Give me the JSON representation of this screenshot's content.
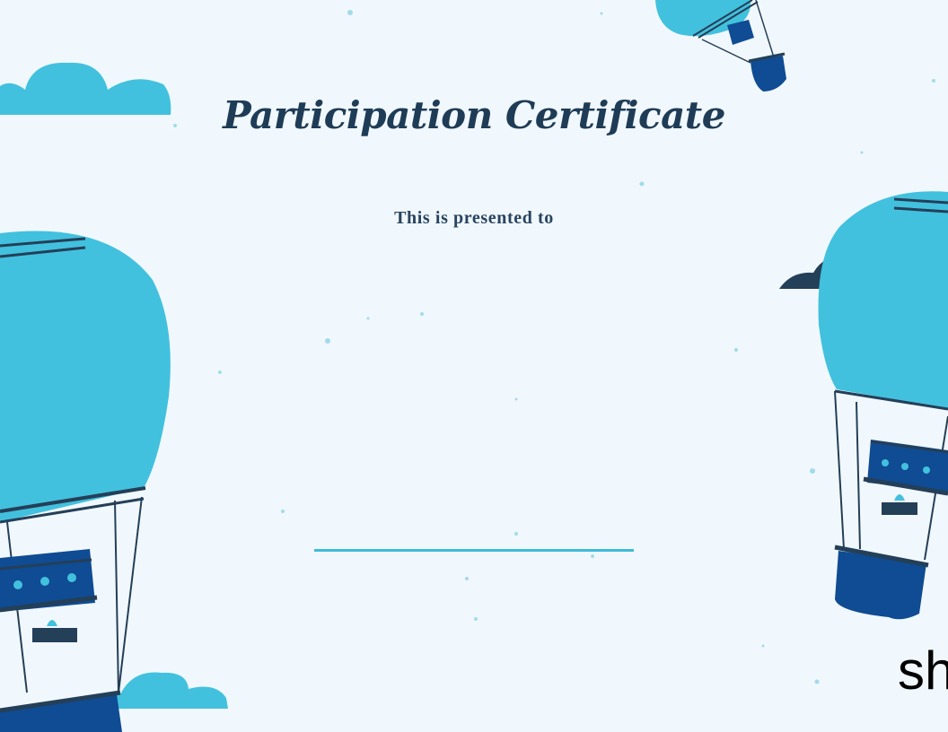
{
  "certificate": {
    "title": "Participation Certificate",
    "subtitle": "This is presented to",
    "recipient_name": ""
  },
  "decorations": {
    "balloons": [
      "hot-air-balloon-left",
      "hot-air-balloon-right",
      "hot-air-balloon-top-right"
    ],
    "clouds": [
      "cloud-top-left",
      "cloud-bottom-left",
      "cloud-right-dark"
    ]
  },
  "logo": {
    "text": "sh"
  },
  "colors": {
    "background": "#f1f8fd",
    "balloon_light": "#42c1de",
    "basket_dark": "#0f4c93",
    "navy": "#243f58",
    "accent_line": "#40bbd9"
  }
}
